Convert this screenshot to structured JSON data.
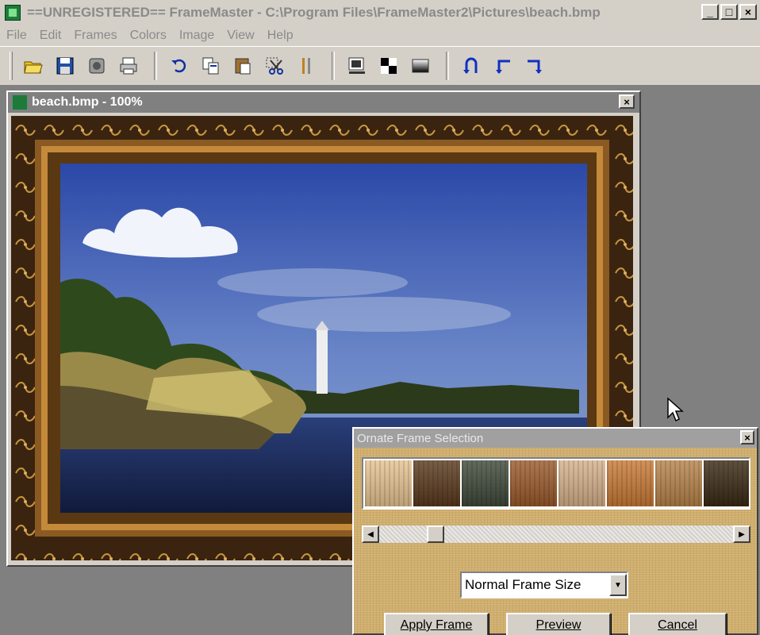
{
  "window": {
    "title": "==UNREGISTERED==  FrameMaster - C:\\Program Files\\FrameMaster2\\Pictures\\beach.bmp",
    "minimize_label": "_",
    "maximize_label": "□",
    "close_label": "×"
  },
  "menu": {
    "items": [
      "File",
      "Edit",
      "Frames",
      "Colors",
      "Image",
      "View",
      "Help"
    ]
  },
  "toolbar": {
    "buttons": [
      "open-icon",
      "save-icon",
      "scan-icon",
      "print-icon",
      "undo-icon",
      "copy-icon",
      "paste-icon",
      "crop-icon",
      "tools-icon",
      "frame-icon",
      "checker-icon",
      "gradient-icon",
      "flip-icon",
      "rotate-left-icon",
      "rotate-right-icon"
    ]
  },
  "image_window": {
    "title": "beach.bmp - 100%",
    "close_label": "×"
  },
  "dialog": {
    "title": "Ornate Frame Selection",
    "close_label": "×",
    "swatch_colors": [
      "#e6c391",
      "#5b3a1e",
      "#3f4a3a",
      "#9a5a2c",
      "#d6b18a",
      "#c97a36",
      "#b7834a",
      "#3b2a14"
    ],
    "scroll_left": "◀",
    "scroll_right": "▶",
    "size_select": {
      "value": "Normal Frame Size",
      "arrow": "▼"
    },
    "buttons": {
      "apply": "Apply Frame",
      "preview": "Preview",
      "cancel": "Cancel"
    }
  },
  "colors": {
    "frame_dark": "#3a2410",
    "frame_gold": "#b07a2a",
    "sky": "#2e4fae",
    "water": "#1d2e5e"
  }
}
